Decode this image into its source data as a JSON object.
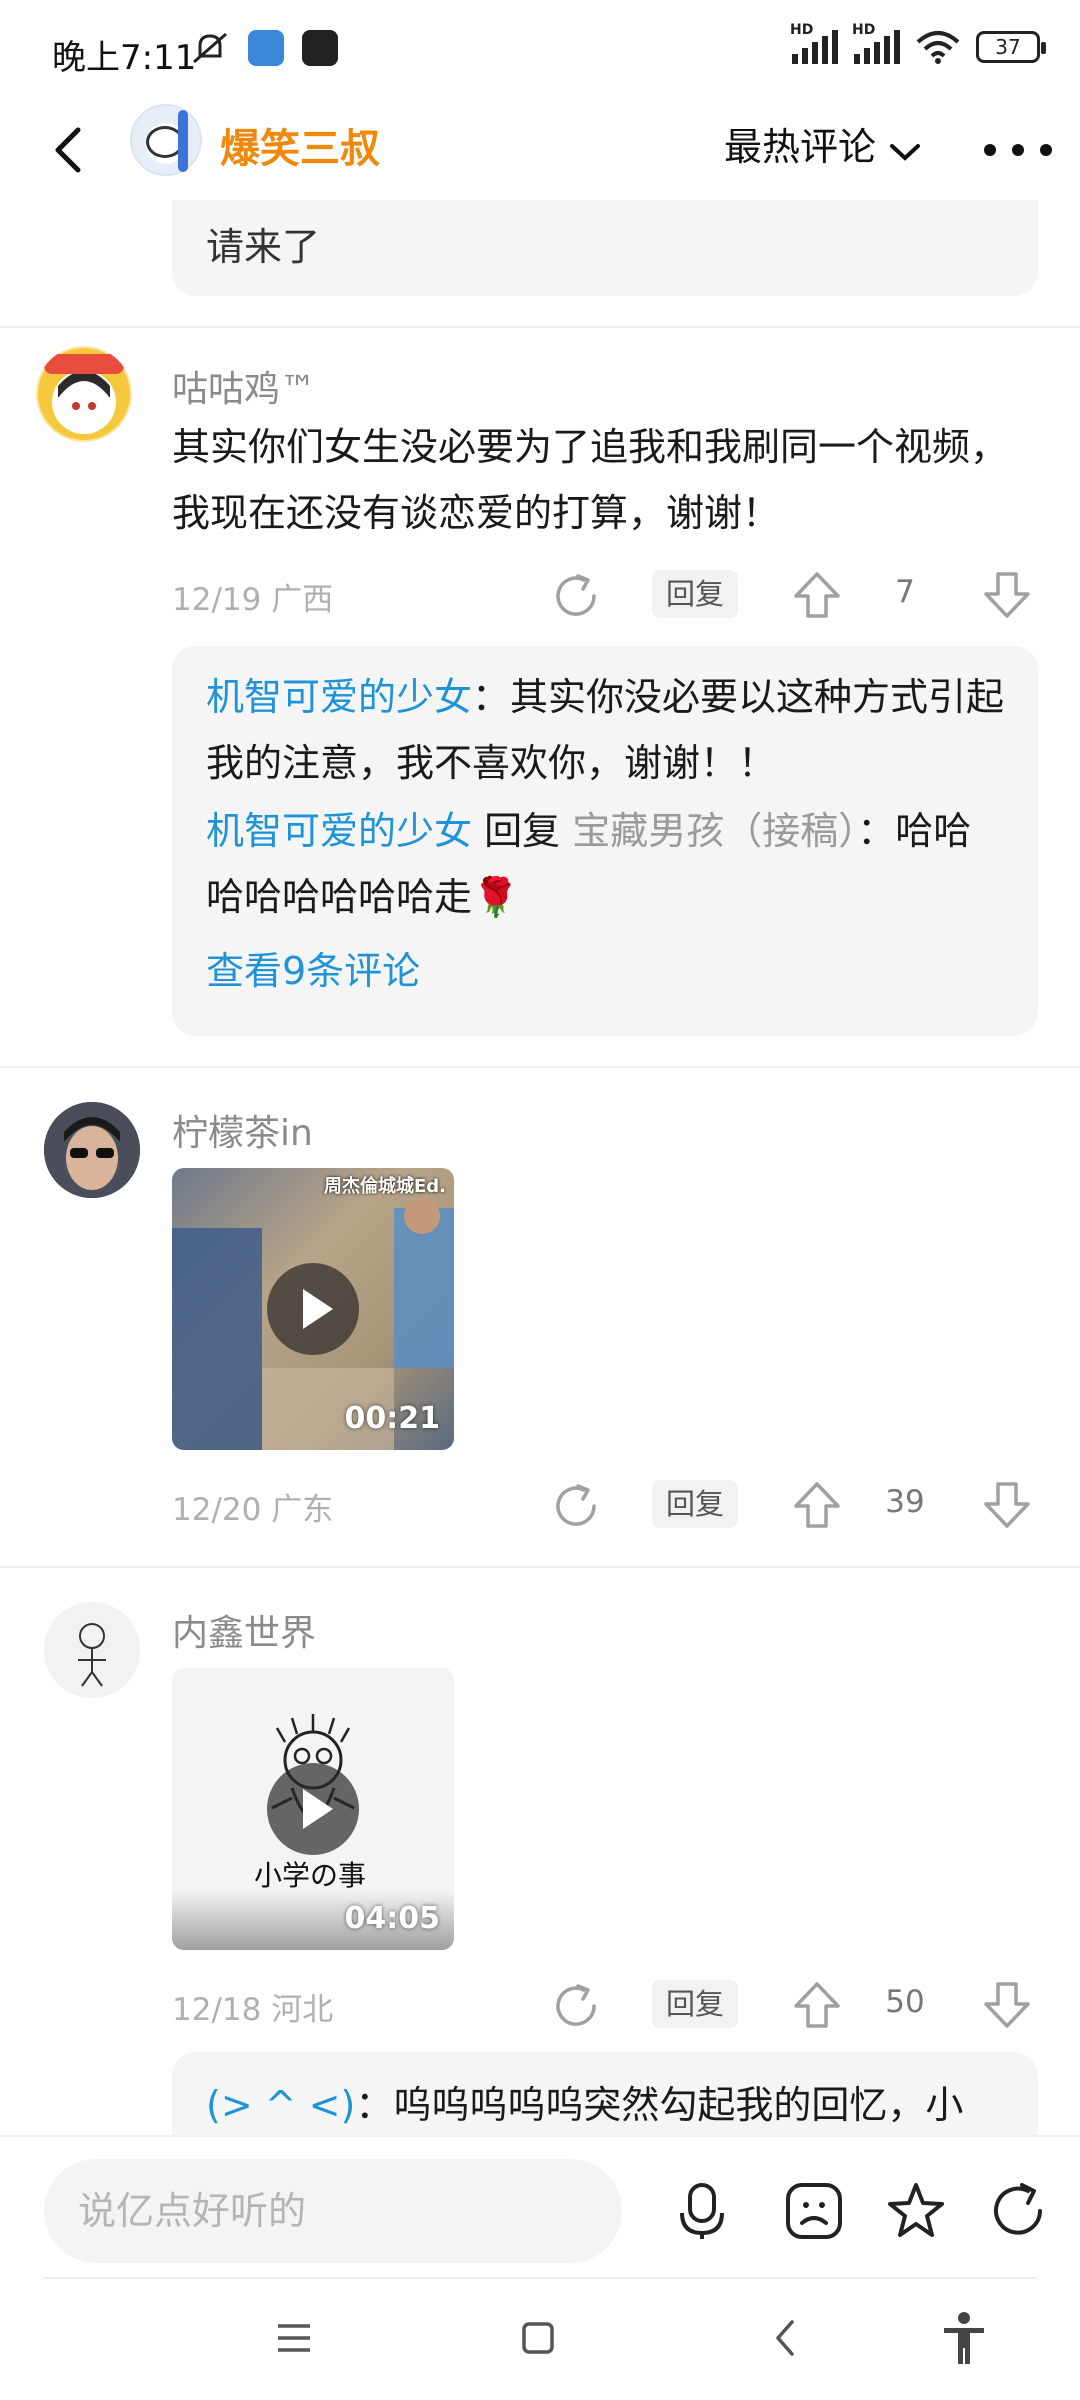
{
  "status_bar": {
    "time": "晚上7:11",
    "signal1_label": "HD",
    "signal2_label": "HD",
    "battery": "37"
  },
  "header": {
    "title": "爆笑三叔",
    "sort_label": "最热评论",
    "back_icon": "chevron-left-icon",
    "more_icon": "more-dots-icon"
  },
  "comments": {
    "top_reply_tail": "请来了",
    "c1": {
      "user": "咕咕鸡™",
      "text": "其实你们女生没必要为了追我和我刷同一个视频，我现在还没有谈恋爱的打算，谢谢！",
      "date": "12/19",
      "region": "广西",
      "reply_label": "回复",
      "likes": "7",
      "replies": {
        "r1_user": "机智可爱的少女",
        "r1_text": "：其实你没必要以这种方式引起我的注意，我不喜欢你，谢谢！！",
        "r2_user": "机智可爱的少女",
        "r2_mid": " 回复 ",
        "r2_target": "宝藏男孩（接稿）",
        "r2_text": "：哈哈哈哈哈哈哈哈走🌹",
        "view_more": "查看9条评论"
      }
    },
    "c2": {
      "user": "柠檬茶in",
      "video_caption": "周杰倫城城Ed.",
      "duration": "00:21",
      "date": "12/20",
      "region": "广东",
      "reply_label": "回复",
      "likes": "39"
    },
    "c3": {
      "user": "内鑫世界",
      "video_caption": "小学の事",
      "duration": "04:05",
      "date": "12/18",
      "region": "河北",
      "reply_label": "回复",
      "likes": "50",
      "reply_user": "(> ^ <)",
      "reply_text": "：呜呜呜呜呜突然勾起我的回忆，小"
    }
  },
  "bottom_bar": {
    "input_placeholder": "说亿点好听的"
  },
  "colors": {
    "accent_orange": "#f0890b",
    "link_blue": "#1f93d8"
  }
}
